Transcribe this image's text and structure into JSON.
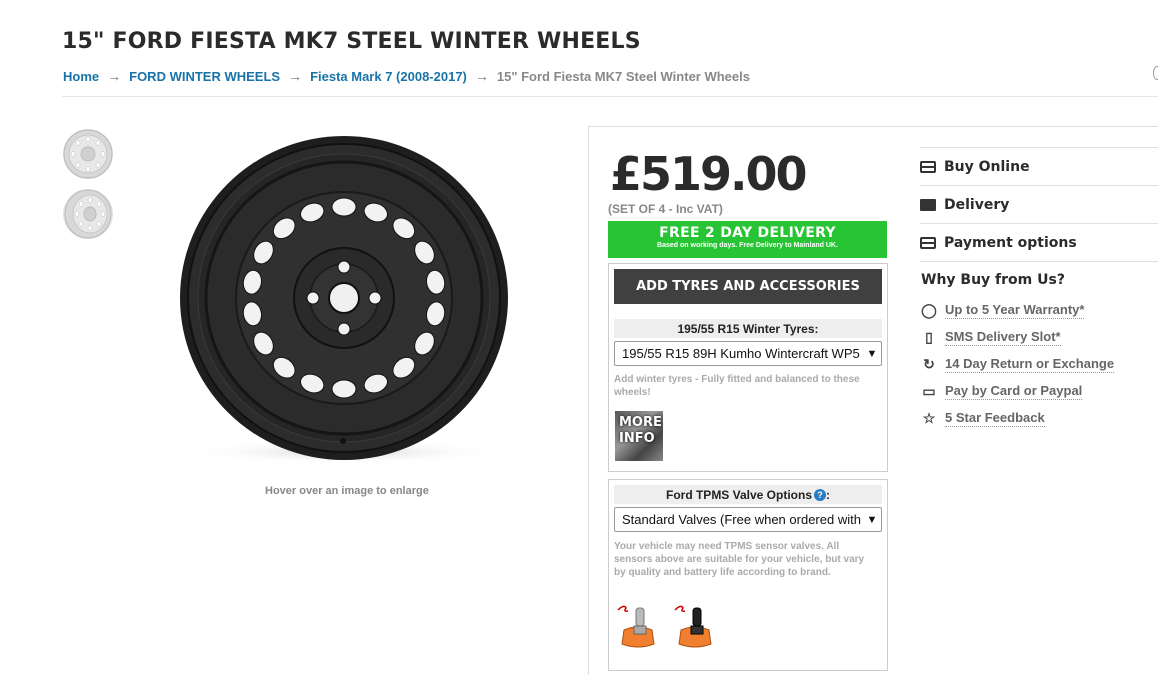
{
  "page": {
    "title": "15\" FORD FIESTA MK7 STEEL WINTER WHEELS"
  },
  "breadcrumb": {
    "items": [
      "Home",
      "FORD WINTER WHEELS",
      "Fiesta Mark 7 (2008-2017)"
    ],
    "current": "15\" Ford Fiesta MK7 Steel Winter Wheels",
    "separator": "→"
  },
  "gallery": {
    "hint": "Hover over an image to enlarge"
  },
  "product": {
    "price": "£519.00",
    "price_note": "(SET OF 4 - Inc VAT)",
    "delivery": {
      "headline": "FREE 2 DAY DELIVERY",
      "subline": "Based on working days. Free Delivery to Mainland UK.",
      "color": "#27c533"
    },
    "tyres": {
      "button_label": "ADD TYRES AND ACCESSORIES",
      "select_label": "195/55 R15 Winter Tyres:",
      "selected": "195/55 R15 89H Kumho Wintercraft WP5",
      "help": "Add winter tyres - Fully fitted and balanced to these wheels!",
      "more_info": "MORE INFO"
    },
    "tpms": {
      "select_label": "Ford TPMS Valve Options",
      "label_suffix": ":",
      "selected": "Standard Valves (Free when ordered with",
      "help": "Your vehicle may need TPMS sensor valves. All sensors above are suitable for your vehicle, but vary by quality and battery life according to brand."
    }
  },
  "side_menu": {
    "items": [
      {
        "label": "Buy Online",
        "icon": "card-icon"
      },
      {
        "label": "Delivery",
        "icon": "truck-icon"
      },
      {
        "label": "Payment options",
        "icon": "card-icon"
      }
    ]
  },
  "why_buy": {
    "title": "Why Buy from Us?",
    "features": [
      {
        "label": "Up to 5 Year Warranty*",
        "icon": "shield-icon"
      },
      {
        "label": "SMS Delivery Slot*",
        "icon": "phone-icon"
      },
      {
        "label": "14 Day Return or Exchange",
        "icon": "refresh-icon"
      },
      {
        "label": "Pay by Card or Paypal",
        "icon": "card-icon"
      },
      {
        "label": "5 Star Feedback",
        "icon": "star-icon"
      }
    ]
  },
  "colors": {
    "link": "#1a73a8",
    "delivery_green": "#27c533",
    "button_dark": "#404040"
  }
}
